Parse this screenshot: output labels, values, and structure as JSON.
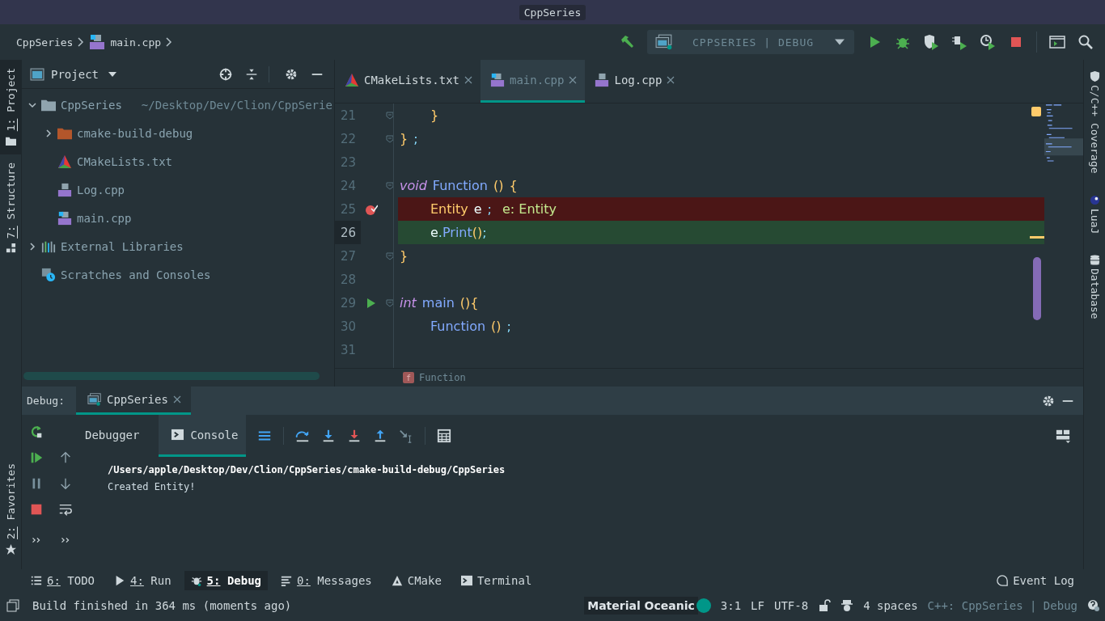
{
  "window": {
    "title": "CppSeries"
  },
  "breadcrumbs": [
    {
      "label": "CppSeries",
      "kind": "project"
    },
    {
      "label": "main.cpp",
      "kind": "cpp-main"
    }
  ],
  "run_config": {
    "label": "CPPSERIES | DEBUG"
  },
  "left_strip": {
    "top": [
      {
        "label": "1: Project",
        "mnemonic": true,
        "selected": true,
        "kind": "folder"
      },
      {
        "label": "7: Structure",
        "mnemonic": true,
        "selected": false,
        "kind": "structure"
      }
    ],
    "bottom": [
      {
        "label": "2: Favorites",
        "mnemonic": true,
        "selected": false,
        "kind": "star"
      }
    ]
  },
  "project": {
    "title": "Project",
    "tree": [
      {
        "label": "CppSeries",
        "path": "~/Desktop/Dev/Clion/CppSerie",
        "kind": "folder",
        "expanded": true,
        "children": [
          {
            "label": "cmake-build-debug",
            "kind": "build-folder",
            "expanded": false
          },
          {
            "label": "CMakeLists.txt",
            "kind": "cmake"
          },
          {
            "label": "Log.cpp",
            "kind": "cpp"
          },
          {
            "label": "main.cpp",
            "kind": "cpp-main"
          }
        ]
      },
      {
        "label": "External Libraries",
        "kind": "libraries",
        "expanded": false
      },
      {
        "label": "Scratches and Consoles",
        "kind": "scratches"
      }
    ]
  },
  "editor": {
    "tabs": [
      {
        "label": "CMakeLists.txt",
        "kind": "cmake",
        "selected": false
      },
      {
        "label": "main.cpp",
        "kind": "cpp-main",
        "selected": true
      },
      {
        "label": "Log.cpp",
        "kind": "cpp",
        "selected": false
      }
    ],
    "lines": [
      {
        "number": "21",
        "kind": "normal",
        "fold": true,
        "indented": true,
        "tokens": [
          {
            "kind": "brace",
            "text": "}"
          }
        ]
      },
      {
        "number": "22",
        "kind": "normal",
        "fold": true,
        "indented": false,
        "tokens": [
          {
            "kind": "brace",
            "text": "}"
          },
          {
            "kind": "punct",
            "text": ";"
          }
        ]
      },
      {
        "number": "23",
        "kind": "normal",
        "fold": false
      },
      {
        "number": "24",
        "kind": "normal",
        "fold": true,
        "indented": false,
        "tokens": [
          {
            "kind": "keyword",
            "text": "void"
          },
          {
            "kind": "function",
            "text": "Function"
          },
          {
            "kind": "brace",
            "text": "()"
          },
          {
            "kind": "brace",
            "text": "{"
          }
        ]
      },
      {
        "number": "25",
        "kind": "breakpoint",
        "gutter_icon": {
          "kind": "breakpoint"
        },
        "fold": false,
        "indented": true,
        "tokens": [
          {
            "kind": "type",
            "text": "Entity"
          },
          {
            "kind": "plain",
            "text": "e"
          },
          {
            "kind": "punct",
            "text": ";"
          },
          {
            "kind": "hint",
            "text": "e: Entity"
          }
        ]
      },
      {
        "number": "26",
        "kind": "current",
        "fold": false,
        "indented": true,
        "tokens": [
          {
            "kind": "plain",
            "text": "e"
          },
          {
            "kind": "punct",
            "text": "."
          },
          {
            "kind": "function",
            "text": "Print"
          },
          {
            "kind": "brace",
            "text": "()"
          },
          {
            "kind": "punct",
            "text": ";"
          }
        ]
      },
      {
        "number": "27",
        "kind": "normal",
        "fold": true,
        "indented": false,
        "tokens": [
          {
            "kind": "brace",
            "text": "}"
          }
        ]
      },
      {
        "number": "28",
        "kind": "normal",
        "fold": false
      },
      {
        "number": "29",
        "kind": "normal",
        "gutter_icon": {
          "kind": "run"
        },
        "fold": true,
        "indented": false,
        "tokens": [
          {
            "kind": "keyword",
            "text": "int"
          },
          {
            "kind": "function",
            "text": "main"
          },
          {
            "kind": "brace",
            "text": "(){"
          }
        ]
      },
      {
        "number": "30",
        "kind": "normal",
        "fold": false,
        "indented": true,
        "tokens": [
          {
            "kind": "function",
            "text": "Function"
          },
          {
            "kind": "brace",
            "text": "()"
          },
          {
            "kind": "punct",
            "text": ";"
          }
        ]
      },
      {
        "number": "31",
        "kind": "normal",
        "fold": false
      }
    ],
    "breadcrumb": {
      "badge": "f",
      "label": "Function"
    }
  },
  "right_strip": [
    {
      "label": "C/C++ Coverage",
      "kind": "shield"
    },
    {
      "label": "LuaJ",
      "kind": "luaj"
    },
    {
      "label": "Database",
      "kind": "database"
    }
  ],
  "debug": {
    "title": "Debug:",
    "session": "CppSeries",
    "tabs": [
      {
        "label": "Debugger",
        "kind": "plain",
        "selected": false
      },
      {
        "label": "Console",
        "kind": "console",
        "selected": true
      }
    ],
    "console": [
      {
        "text": "/Users/apple/Desktop/Dev/Clion/CppSeries/cmake-build-debug/CppSeries",
        "kind": "command"
      },
      {
        "text": "Created Entity!",
        "kind": "output"
      }
    ]
  },
  "tool_buttons": [
    {
      "label": "6: TODO",
      "mnemonic": true,
      "selected": false,
      "kind": "list"
    },
    {
      "label": "4: Run",
      "mnemonic": true,
      "selected": false,
      "kind": "run"
    },
    {
      "label": "5: Debug",
      "mnemonic": true,
      "selected": true,
      "kind": "debug"
    },
    {
      "label": "0: Messages",
      "mnemonic": true,
      "selected": false,
      "kind": "messages"
    },
    {
      "label": "CMake",
      "mnemonic": false,
      "selected": false,
      "kind": "cmake"
    },
    {
      "label": "Terminal",
      "mnemonic": false,
      "selected": false,
      "kind": "terminal"
    }
  ],
  "event_log": "Event Log",
  "status_bar": {
    "message": "Build finished in 364 ms (moments ago)",
    "theme": {
      "label": "Material Oceanic",
      "color": "#009688"
    },
    "position": "3:1",
    "line_separator": "LF",
    "encoding": "UTF-8",
    "indent": "4 spaces",
    "context": "C++: CppSeries | Debug"
  }
}
